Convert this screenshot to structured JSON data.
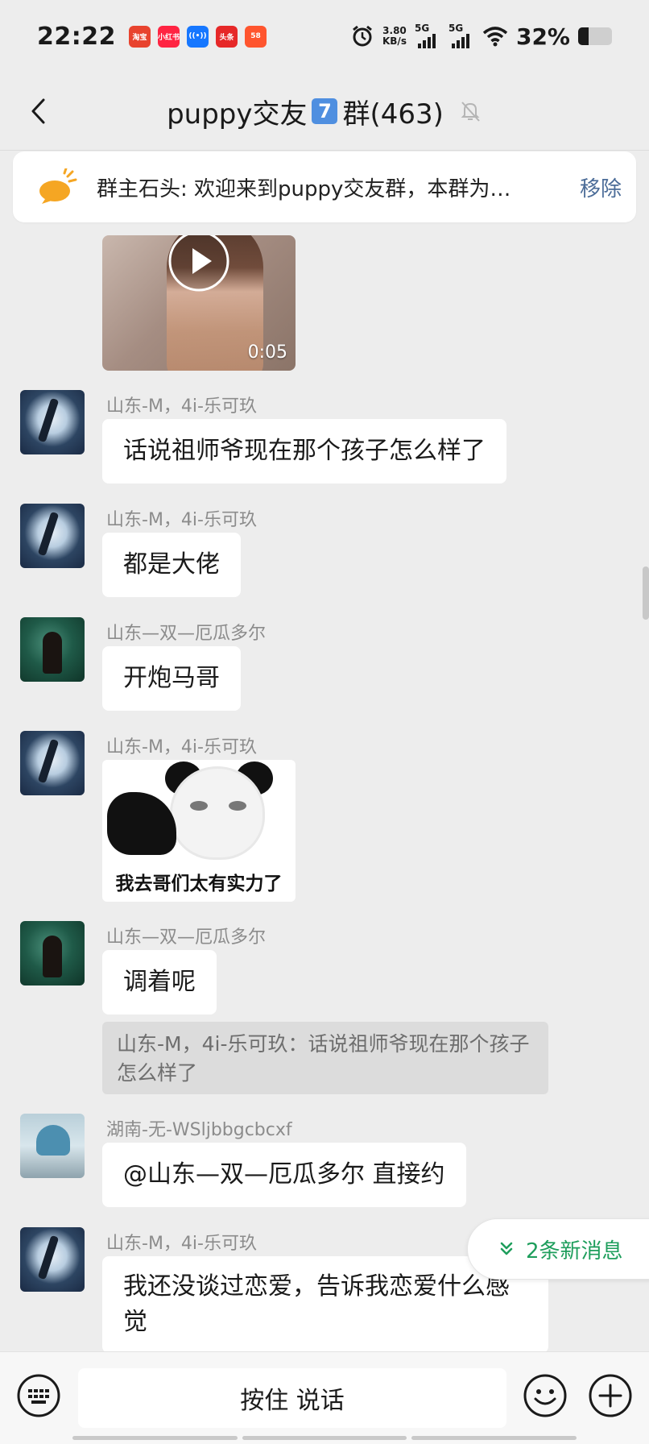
{
  "status_bar": {
    "time": "22:22",
    "app_badges": [
      {
        "name": "taobao-app-icon",
        "label": "淘宝",
        "color": "#e8432e"
      },
      {
        "name": "xiaohongshu-app-icon",
        "label": "小红书",
        "color": "#ff2442"
      },
      {
        "name": "nfc-app-icon",
        "label": "((•))",
        "color": "#1677ff"
      },
      {
        "name": "toutiao-app-icon",
        "label": "头条",
        "color": "#e62828"
      },
      {
        "name": "58-app-icon",
        "label": "58",
        "color": "#ff552e"
      }
    ],
    "speed_value": "3.80",
    "speed_unit": "KB/s",
    "network_1": "5G",
    "network_2": "5G",
    "battery": "32%",
    "battery_level": 0.32
  },
  "header": {
    "title_prefix": "puppy交友",
    "title_badge": "7",
    "title_suffix": "群(463)"
  },
  "announcement": {
    "text": "群主石头: 欢迎来到puppy交友群，本群为…",
    "remove_label": "移除"
  },
  "video_message": {
    "duration": "0:05"
  },
  "messages": [
    {
      "sender": "山东-M，4i-乐可玖",
      "text": "话说祖师爷现在那个孩子怎么样了"
    },
    {
      "sender": "山东-M，4i-乐可玖",
      "text": "都是大佬"
    },
    {
      "sender": "山东—双—厄瓜多尔",
      "text": "开炮马哥"
    },
    {
      "sender": "山东-M，4i-乐可玖",
      "sticker_caption": "我去哥们太有实力了"
    },
    {
      "sender": "山东—双—厄瓜多尔",
      "text": "调着呢",
      "quote": "山东-M，4i-乐可玖：话说祖师爷现在那个孩子怎么样了"
    },
    {
      "sender": "湖南-无-WSljbbgcbcxf",
      "text": "@山东—双—厄瓜多尔  直接约"
    },
    {
      "sender": "山东-M，4i-乐可玖",
      "text": "我还没谈过恋爱，告诉我恋爱什么感觉"
    }
  ],
  "new_messages": {
    "label": "2条新消息"
  },
  "input_bar": {
    "voice_label": "按住 说话"
  },
  "colors": {
    "background": "#ededed",
    "link": "#4b6c98",
    "new_message_green": "#1e9e5c",
    "announce_icon": "#f5a623"
  }
}
